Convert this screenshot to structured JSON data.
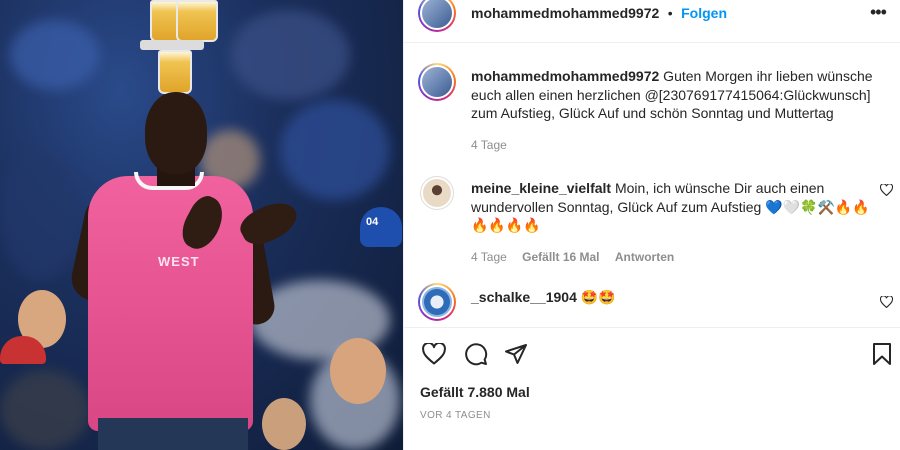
{
  "post": {
    "author": "mohammedmohammed9972",
    "follow_label": "Folgen",
    "more_label": "•••",
    "photo_shirt_text": "WEST",
    "photo_cap_text": "04"
  },
  "caption": {
    "author": "mohammedmohammed9972",
    "text": " Guten Morgen ihr lieben wünsche euch allen einen herzlichen @[230769177415064:Glückwunsch] zum Aufstieg, Glück Auf und schön Sonntag und Muttertag",
    "time": "4 Tage"
  },
  "comments": [
    {
      "author": "meine_kleine_vielfalt",
      "text": " Moin, ich wünsche Dir auch einen wundervollen Sonntag, Glück Auf zum Aufstieg 💙🤍🍀⚒️🔥🔥🔥🔥🔥🔥",
      "time": "4 Tage",
      "likes": "Gefällt 16 Mal",
      "reply": "Antworten"
    },
    {
      "author": "_schalke__1904",
      "text": " 🤩🤩"
    }
  ],
  "footer": {
    "likes": "Gefällt 7.880 Mal",
    "date": "VOR 4 TAGEN"
  },
  "icons": {
    "like": "heart-icon",
    "comment": "comment-icon",
    "share": "paper-plane-icon",
    "save": "bookmark-icon"
  }
}
